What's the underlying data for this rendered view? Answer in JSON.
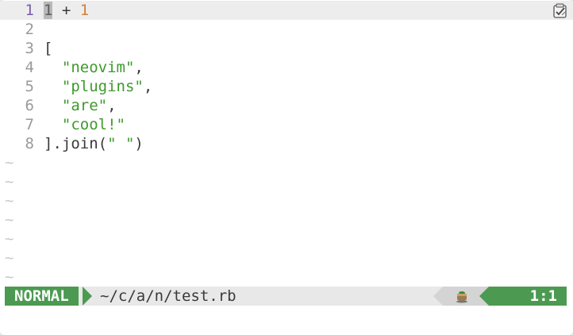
{
  "editor": {
    "lines": [
      {
        "number": "1",
        "tokens": [
          {
            "t": "1",
            "kind": "cursor"
          },
          {
            "t": " + ",
            "kind": "punc"
          },
          {
            "t": "1",
            "kind": "num"
          }
        ]
      },
      {
        "number": "2",
        "tokens": []
      },
      {
        "number": "3",
        "tokens": [
          {
            "t": "[",
            "kind": "punc"
          }
        ]
      },
      {
        "number": "4",
        "tokens": [
          {
            "t": "  ",
            "kind": "punc"
          },
          {
            "t": "\"neovim\"",
            "kind": "str"
          },
          {
            "t": ",",
            "kind": "punc"
          }
        ]
      },
      {
        "number": "5",
        "tokens": [
          {
            "t": "  ",
            "kind": "punc"
          },
          {
            "t": "\"plugins\"",
            "kind": "str"
          },
          {
            "t": ",",
            "kind": "punc"
          }
        ]
      },
      {
        "number": "6",
        "tokens": [
          {
            "t": "  ",
            "kind": "punc"
          },
          {
            "t": "\"are\"",
            "kind": "str"
          },
          {
            "t": ",",
            "kind": "punc"
          }
        ]
      },
      {
        "number": "7",
        "tokens": [
          {
            "t": "  ",
            "kind": "punc"
          },
          {
            "t": "\"cool!\"",
            "kind": "str"
          }
        ]
      },
      {
        "number": "8",
        "tokens": [
          {
            "t": "].join(",
            "kind": "punc"
          },
          {
            "t": "\" \"",
            "kind": "str"
          },
          {
            "t": ")",
            "kind": "punc"
          }
        ]
      }
    ],
    "tilde_glyph": "~",
    "tilde_count": 7,
    "sign_icon": "checklist-icon"
  },
  "statusline": {
    "mode": "NORMAL",
    "filename": "~/c/a/n/test.rb",
    "position": "1:1",
    "indicator_icon": "pot-icon",
    "accent_color": "#4c9a52"
  },
  "colors": {
    "number": "#d0813a",
    "string": "#3e9a2c",
    "line_number": "#9a9a9a",
    "current_line_number": "#7a5ea8",
    "tilde": "#c9c9c9"
  }
}
